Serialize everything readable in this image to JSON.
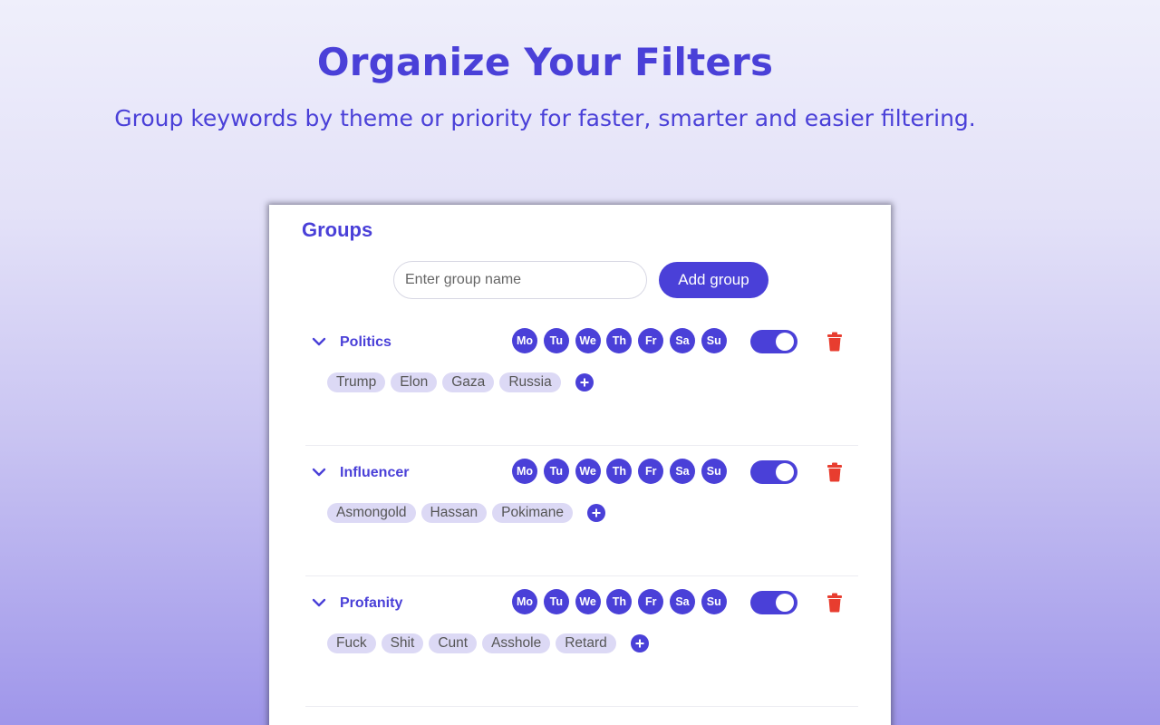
{
  "hero": {
    "title": "Organize Your Filters",
    "subtitle": "Group keywords by theme or priority for faster, smarter and easier filtering."
  },
  "panel": {
    "title": "Groups",
    "input_placeholder": "Enter group name",
    "input_value": "",
    "add_button": "Add group"
  },
  "days": [
    "Mo",
    "Tu",
    "We",
    "Th",
    "Fr",
    "Sa",
    "Su"
  ],
  "groups": [
    {
      "name": "Politics",
      "enabled": true,
      "keywords": [
        "Trump",
        "Elon",
        "Gaza",
        "Russia"
      ]
    },
    {
      "name": "Influencer",
      "enabled": true,
      "keywords": [
        "Asmongold",
        "Hassan",
        "Pokimane"
      ]
    },
    {
      "name": "Profanity",
      "enabled": true,
      "keywords": [
        "Fuck",
        "Shit",
        "Cunt",
        "Asshole",
        "Retard"
      ]
    }
  ],
  "colors": {
    "accent": "#4a40d8",
    "tag_bg": "#dcd9f5",
    "delete": "#e83d2f"
  },
  "icons": {
    "expand": "chevron-down-icon",
    "delete": "trash-icon",
    "add_keyword": "plus-icon"
  }
}
